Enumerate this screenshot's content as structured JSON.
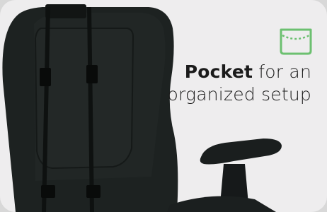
{
  "feature": {
    "highlight": "Pocket",
    "line1_rest": " for an",
    "line2": "organized setup"
  },
  "icon": {
    "name": "pocket-icon",
    "color": "#6cc070"
  },
  "colors": {
    "background": "#eeedee",
    "chair": "#1f2322",
    "strap": "#0d0f0f"
  }
}
